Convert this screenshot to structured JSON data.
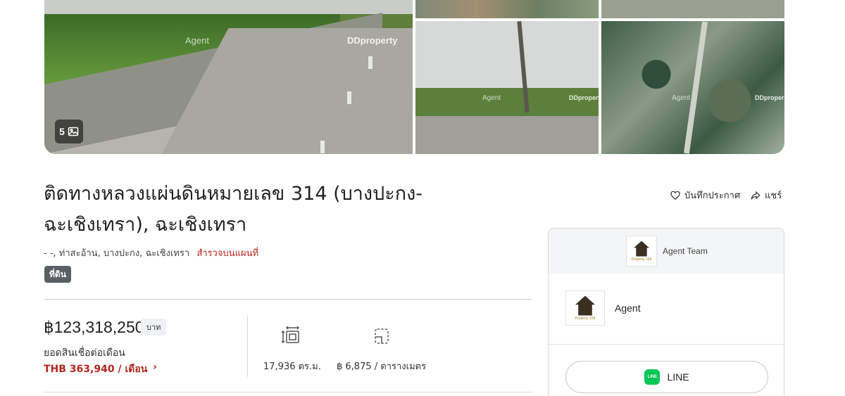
{
  "gallery": {
    "watermark_brand": "DDproperty",
    "watermark_agent": "Agent",
    "photo_count": "5",
    "photo_icon": "image-icon"
  },
  "listing": {
    "title_line1": "ติดทางหลวงแผ่นดินหมายเลข 314 (บางปะกง-",
    "title_line2": "ฉะเชิงเทรา), ฉะเชิงเทรา",
    "address": "- -, ท่าสะอ้าน, บางปะกง, ฉะเชิงเทรา",
    "map_link": "สำรวจบนแผนที่",
    "property_type": "ที่ดิน"
  },
  "actions": {
    "save_label": "บันทึกประกาศ",
    "save_icon": "heart-icon",
    "share_label": "แชร์",
    "share_icon": "share-icon"
  },
  "pricing": {
    "price": "฿123,318,250",
    "currency_badge": "บาท",
    "mortgage_label": "ยอดสินเชื่อต่อเดือน",
    "mortgage_value": "THB 363,940 / เดือน",
    "mortgage_chevron": "›",
    "accent_color": "#b3261e"
  },
  "stats": {
    "area": "17,936 ตร.ม.",
    "area_icon": "area-resize-icon",
    "price_per_area": "฿ 6,875 / ตารางเมตร",
    "price_per_area_icon": "floor-plan-icon"
  },
  "agent_card": {
    "team_name": "Agent Team",
    "agent_name": "Agent",
    "logo_text": "Property 168",
    "line_label": "LINE",
    "line_color": "#06c755"
  }
}
